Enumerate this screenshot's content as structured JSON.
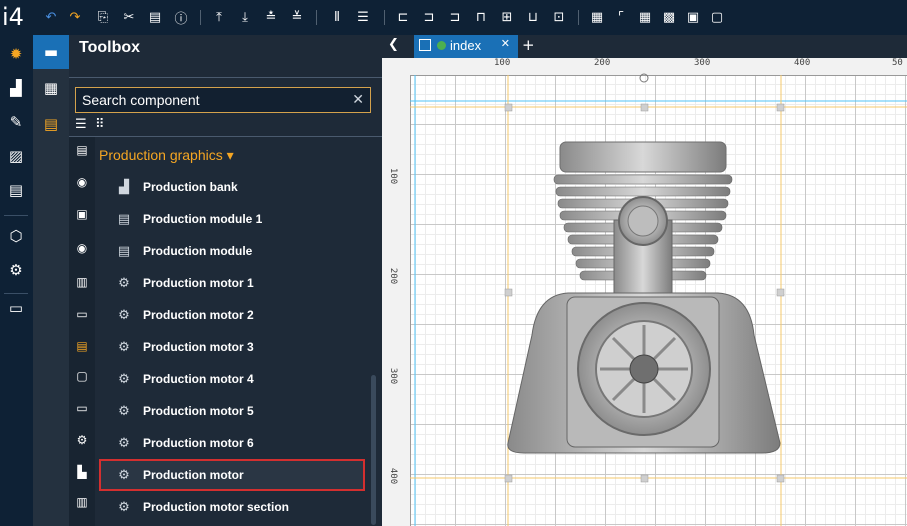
{
  "app": {
    "logo": "i4"
  },
  "toolbar": {
    "icons": [
      "undo-icon",
      "redo-icon",
      "copy-icon",
      "cut-icon",
      "paste-icon",
      "info-icon",
      "align-top-icon",
      "align-bottom-icon",
      "bring-front-icon",
      "send-back-icon",
      "distribute-vertical-icon",
      "distribute-horizontal-icon",
      "align-left-icon",
      "align-center-icon",
      "align-right-icon",
      "align-top-edge-icon",
      "align-middle-icon",
      "align-bottom-edge-icon",
      "center-icon",
      "grid-icon",
      "guide-icon",
      "table-icon",
      "snap-icon",
      "group-icon",
      "ungroup-icon"
    ]
  },
  "rail": {
    "icons": [
      "gear-icon",
      "chart-icon",
      "pen-icon",
      "image-icon",
      "list-icon",
      "cube-icon",
      "gear-monitor-icon",
      "archive-icon"
    ]
  },
  "rail2": {
    "icons": [
      "toolbox-icon",
      "properties-icon",
      "document-icon"
    ]
  },
  "toolbox": {
    "title": "Toolbox",
    "search_placeholder": "Search component",
    "search_value": "",
    "group_label": "Production graphics ▾",
    "items": [
      {
        "label": "Production bank",
        "icon": "bank-icon"
      },
      {
        "label": "Production module 1",
        "icon": "module-icon"
      },
      {
        "label": "Production module",
        "icon": "module-icon"
      },
      {
        "label": "Production motor 1",
        "icon": "motor-icon"
      },
      {
        "label": "Production motor 2",
        "icon": "motor-icon"
      },
      {
        "label": "Production motor 3",
        "icon": "motor-icon"
      },
      {
        "label": "Production motor 4",
        "icon": "motor-icon"
      },
      {
        "label": "Production motor 5",
        "icon": "motor-icon"
      },
      {
        "label": "Production motor 6",
        "icon": "motor-icon"
      },
      {
        "label": "Production motor",
        "icon": "motor-icon",
        "selected": true
      },
      {
        "label": "Production motor section",
        "icon": "motor-icon"
      }
    ],
    "categories": [
      "list-icon",
      "lock-icon",
      "camera-icon",
      "eye-icon",
      "book-icon",
      "rectangle-icon",
      "list-box-icon",
      "frame-icon",
      "button-icon",
      "gears-icon",
      "pump-icon",
      "tank-icon"
    ]
  },
  "editor": {
    "tab_label": "index",
    "ruler_h": [
      "100",
      "200",
      "300",
      "400",
      "50"
    ],
    "ruler_v": [
      "100",
      "200",
      "300",
      "400"
    ],
    "selection_color": "#f5a623",
    "guide_color": "#4fc3f7"
  },
  "colors": {
    "accent": "#1a70b6",
    "toolbar_bg": "#0e2135",
    "selected_outline": "#d32f2f",
    "group_label": "#f5a623"
  }
}
